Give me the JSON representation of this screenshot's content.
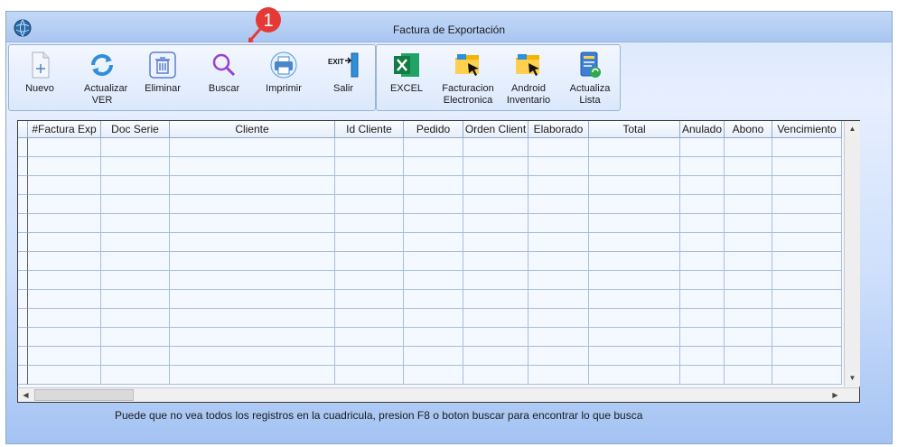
{
  "window": {
    "title": "Factura de Exportación"
  },
  "toolbar_main": [
    {
      "key": "nuevo",
      "label": "Nuevo",
      "icon": "new-document-icon"
    },
    {
      "key": "actualizar",
      "label": "Actualizar VER",
      "icon": "refresh-icon"
    },
    {
      "key": "eliminar",
      "label": "Eliminar",
      "icon": "trash-icon"
    },
    {
      "key": "buscar",
      "label": "Buscar",
      "icon": "search-icon"
    },
    {
      "key": "imprimir",
      "label": "Imprimir",
      "icon": "printer-icon"
    },
    {
      "key": "salir",
      "label": "Salir",
      "icon": "exit-icon"
    }
  ],
  "toolbar_extra": [
    {
      "key": "excel",
      "label": "EXCEL",
      "icon": "excel-icon"
    },
    {
      "key": "facturacion",
      "label": "Facturacion Electronica",
      "icon": "folder-cursor-icon"
    },
    {
      "key": "android",
      "label": "Android Inventario",
      "icon": "folder-cursor-icon"
    },
    {
      "key": "actualiza_lista",
      "label": "Actualiza Lista",
      "icon": "list-refresh-icon"
    }
  ],
  "grid": {
    "columns": [
      "#Factura Exp",
      "Doc Serie",
      "Cliente",
      "Id Cliente",
      "Pedido",
      "Orden Client",
      "Elaborado",
      "Total",
      "Anulado",
      "Abono",
      "Vencimiento"
    ],
    "row_count": 13
  },
  "hint": "Puede que no vea todos los registros en la cuadricula, presion F8 o boton buscar para encontrar lo que busca",
  "annotation": {
    "number": "1"
  },
  "colors": {
    "accent": "#e53935",
    "title_bar": "#a9c6f1",
    "grid_background": "#f4f8ff"
  }
}
